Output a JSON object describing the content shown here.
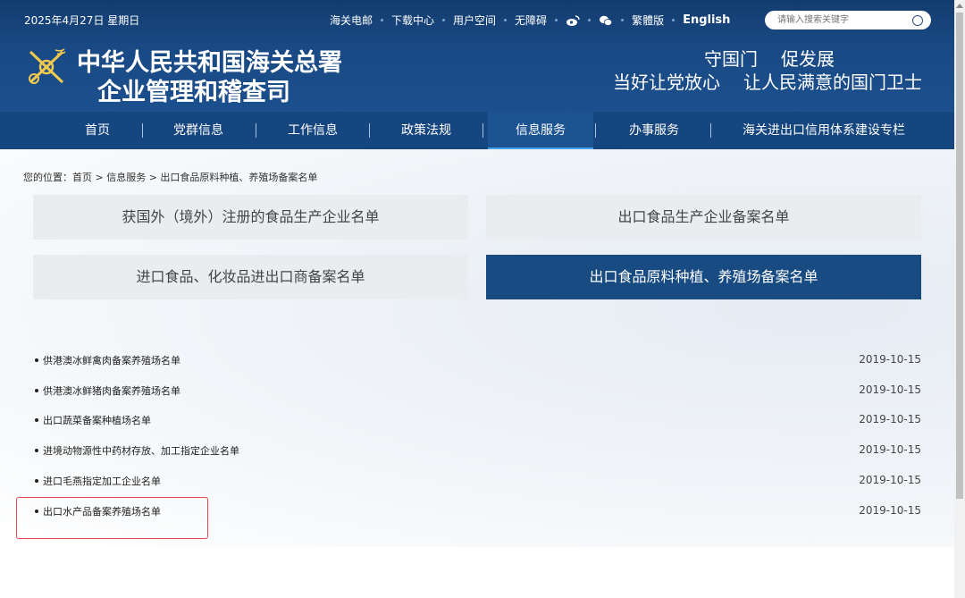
{
  "header": {
    "date": "2025年4月27日 星期日",
    "links": [
      "海关电邮",
      "下载中心",
      "用户空间",
      "无障碍",
      "繁體版",
      "English"
    ],
    "search_placeholder": "请输入搜索关键字",
    "title_line1": "中华人民共和国海关总署",
    "title_line2": "企业管理和稽查司",
    "slogan1a": "守国门",
    "slogan1b": "促发展",
    "slogan2a": "当好让党放心",
    "slogan2b": "让人民满意的国门卫士"
  },
  "nav": {
    "items": [
      "首页",
      "党群信息",
      "工作信息",
      "政策法规",
      "信息服务",
      "办事服务",
      "海关进出口信用体系建设专栏"
    ],
    "active_index": 4
  },
  "breadcrumb": "您的位置：首页 > 信息服务 > 出口食品原料种植、养殖场备案名单",
  "categories": [
    "获国外（境外）注册的食品生产企业名单",
    "出口食品生产企业备案名单",
    "进口食品、化妆品进出口商备案名单",
    "出口食品原料种植、养殖场备案名单"
  ],
  "active_category": 3,
  "list": [
    {
      "title": "供港澳冰鲜禽肉备案养殖场名单",
      "date": "2019-10-15"
    },
    {
      "title": "供港澳冰鲜猪肉备案养殖场名单",
      "date": "2019-10-15"
    },
    {
      "title": "出口蔬菜备案种植场名单",
      "date": "2019-10-15"
    },
    {
      "title": "进境动物源性中药材存放、加工指定企业名单",
      "date": "2019-10-15"
    },
    {
      "title": "进口毛燕指定加工企业名单",
      "date": "2019-10-15"
    },
    {
      "title": "出口水产品备案养殖场名单",
      "date": "2019-10-15"
    }
  ],
  "colors": {
    "header_bg": "#1a4a85",
    "nav_bg": "#16467f",
    "active_category_bg": "#174b82",
    "highlight_border": "#e4474c"
  }
}
